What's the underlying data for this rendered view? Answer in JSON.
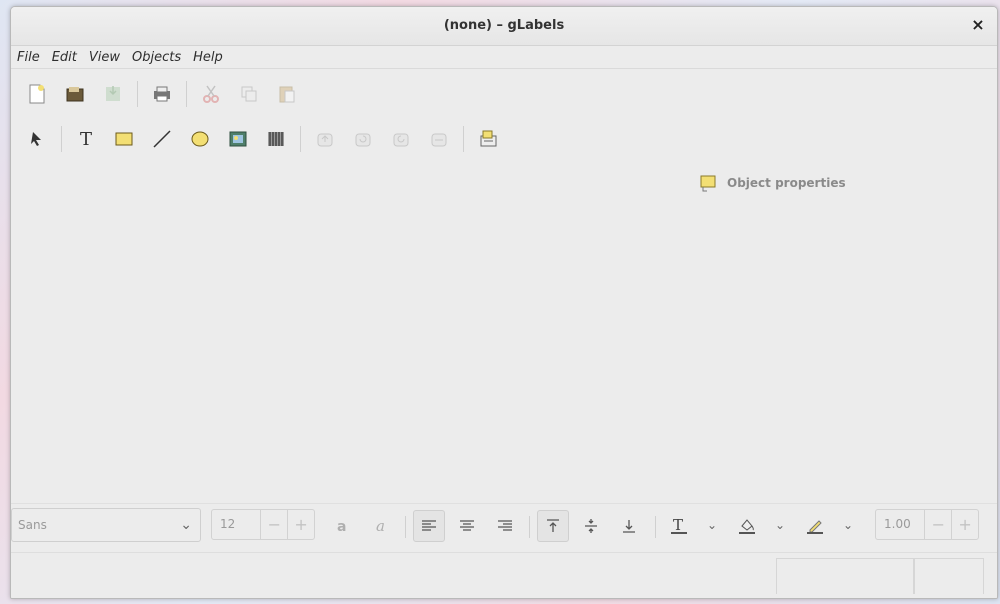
{
  "window": {
    "title": "(none) – gLabels",
    "close_glyph": "×"
  },
  "menubar": {
    "items": [
      "File",
      "Edit",
      "View",
      "Objects",
      "Help"
    ]
  },
  "toolbar_main": {
    "buttons": [
      "new-icon",
      "open-icon",
      "save-icon",
      "print-icon",
      "cut-icon",
      "copy-icon",
      "paste-icon"
    ]
  },
  "toolbar_drawing": {
    "buttons": [
      "select-arrow-icon",
      "text-tool-icon",
      "box-tool-icon",
      "line-tool-icon",
      "ellipse-tool-icon",
      "image-tool-icon",
      "barcode-tool-icon",
      "raise-icon",
      "lower-icon",
      "rotate-left-icon",
      "rotate-right-icon",
      "merge-properties-icon"
    ],
    "text_tool_glyph": "T"
  },
  "properties_panel": {
    "label": "Object properties"
  },
  "format_toolbar": {
    "font_family": "Sans",
    "font_size": "12",
    "line_width": "1.00",
    "minus": "−",
    "plus": "+",
    "dropdown_glyph": "⌄"
  },
  "colors": {
    "accent_yellow": "#f3df74",
    "cut_red": "#d24a4a",
    "window_bg": "#ececec"
  }
}
